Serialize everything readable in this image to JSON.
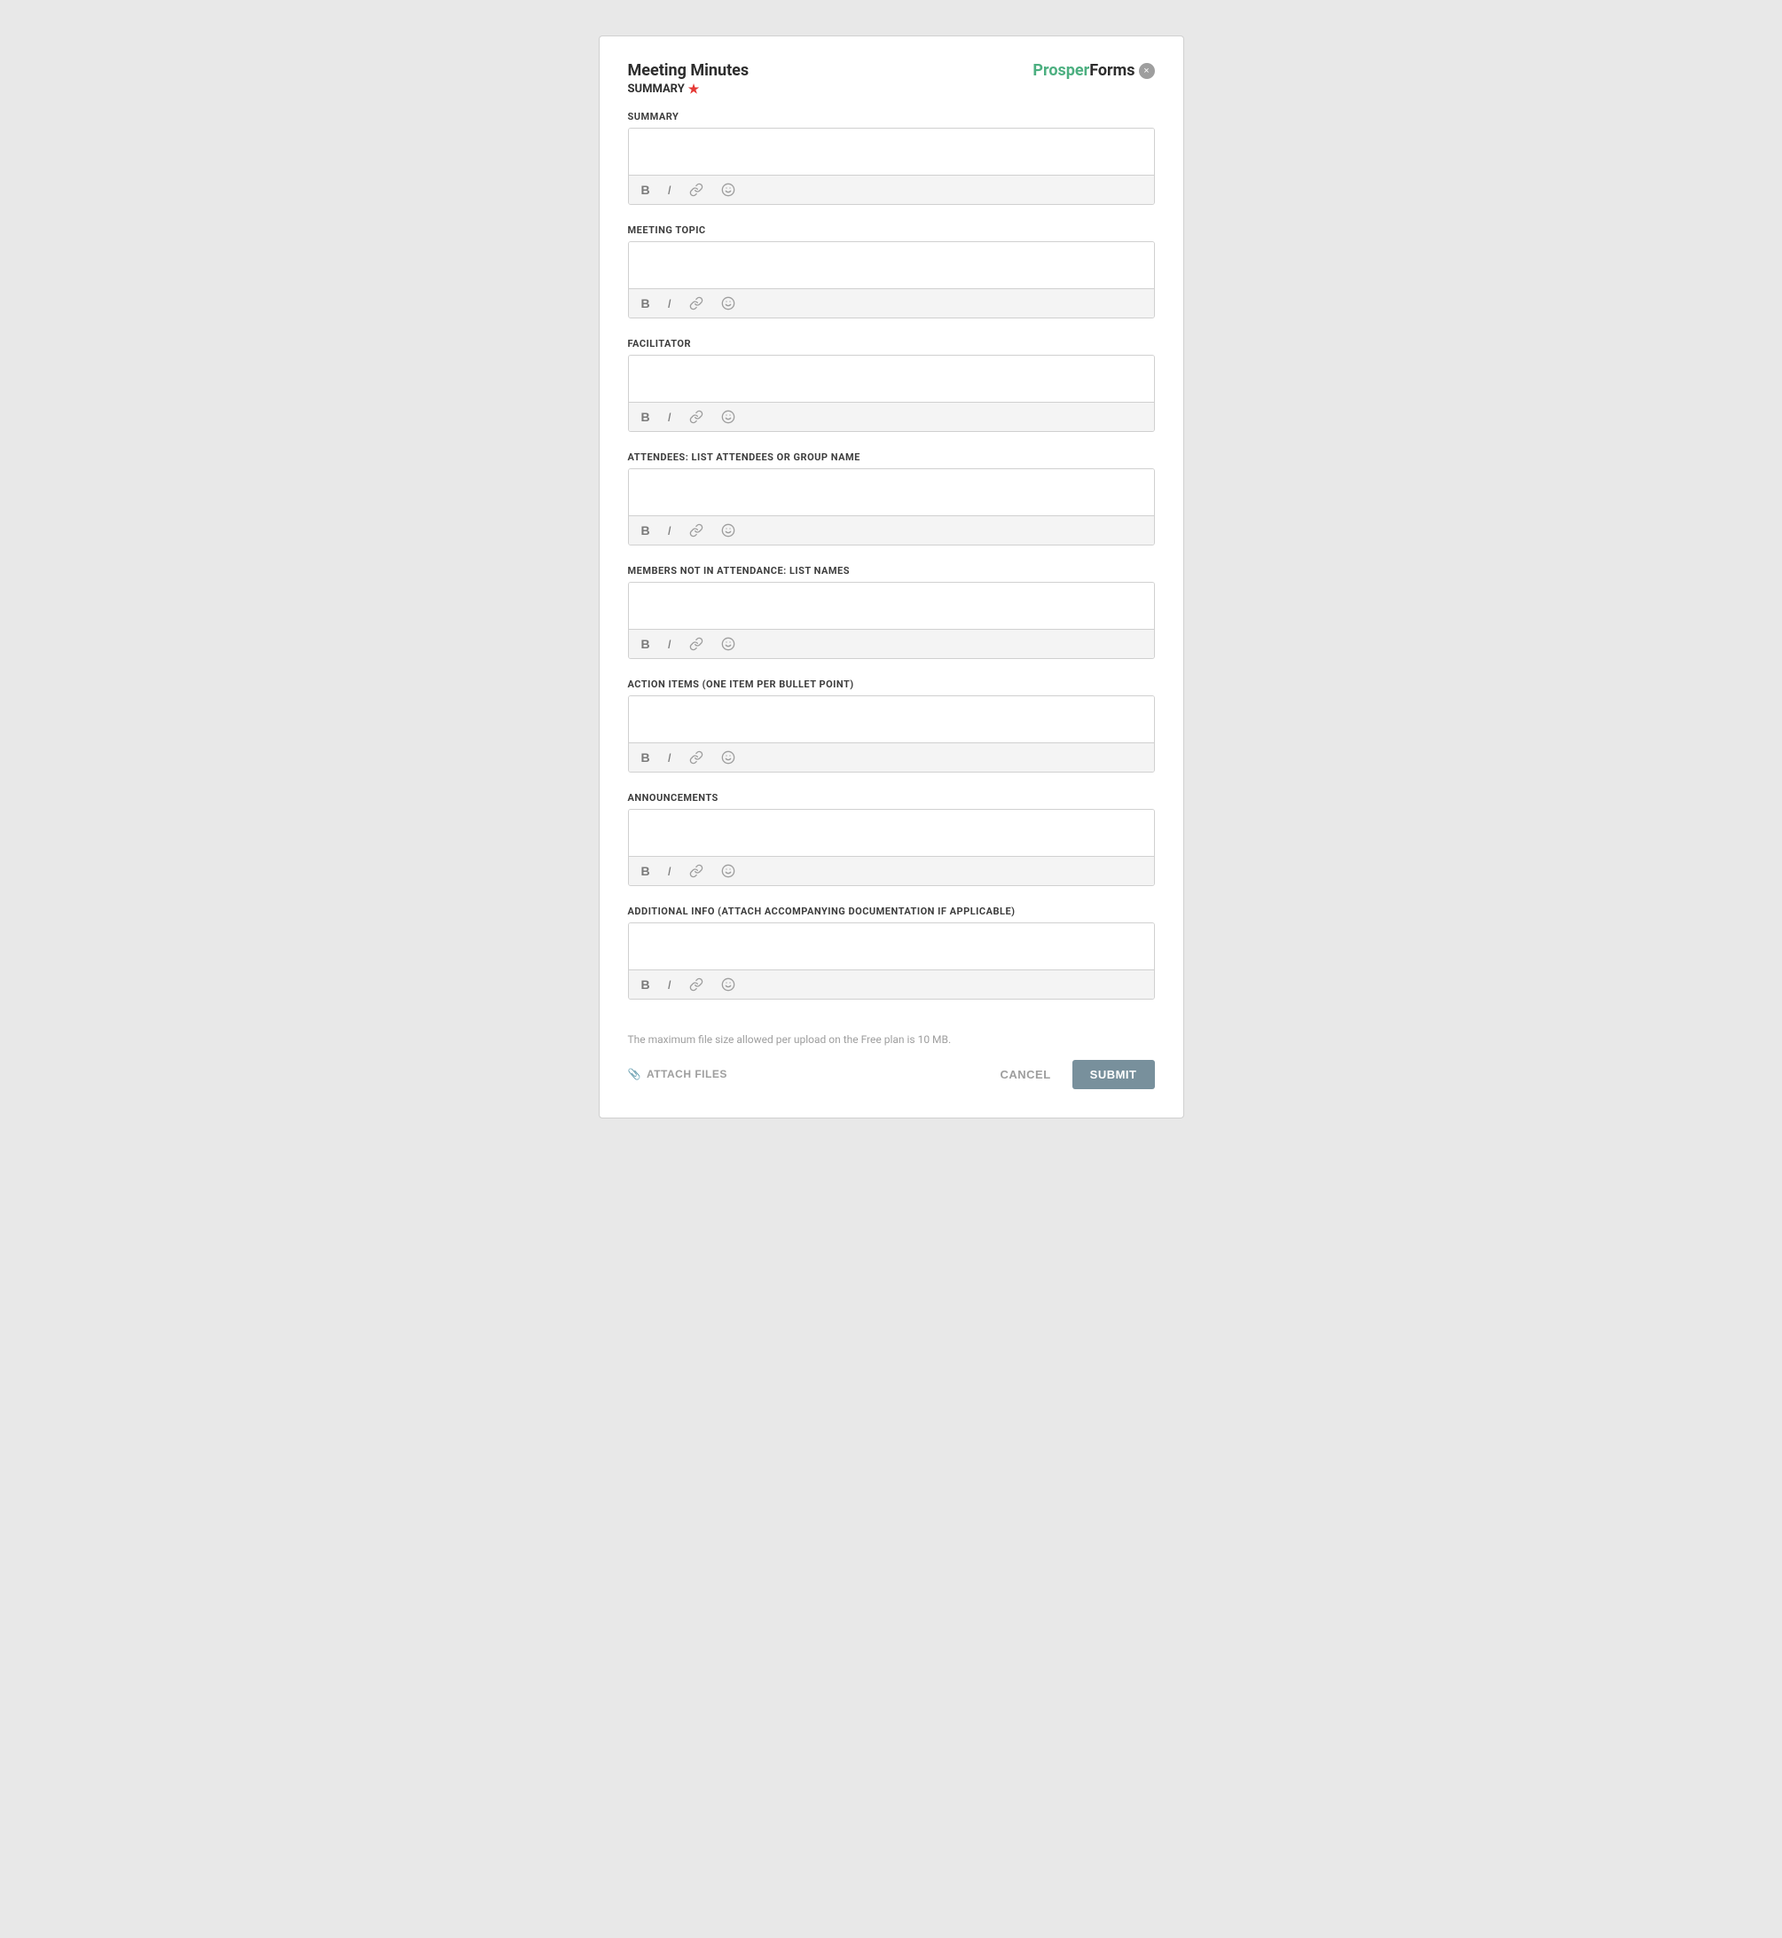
{
  "header": {
    "title": "Meeting Minutes",
    "subtitle": "SUMMARY",
    "required_indicator": "★",
    "logo_prosper": "Prosper",
    "logo_forms": "Forms",
    "close_label": "×"
  },
  "fields": [
    {
      "id": "summary",
      "label": "SUMMARY",
      "required": true,
      "placeholder": ""
    },
    {
      "id": "meeting_topic",
      "label": "MEETING TOPIC",
      "required": false,
      "placeholder": ""
    },
    {
      "id": "facilitator",
      "label": "FACILITATOR",
      "required": false,
      "placeholder": ""
    },
    {
      "id": "attendees",
      "label": "ATTENDEES: LIST ATTENDEES OR GROUP NAME",
      "required": false,
      "placeholder": ""
    },
    {
      "id": "members_not_attending",
      "label": "MEMBERS NOT IN ATTENDANCE: LIST NAMES",
      "required": false,
      "placeholder": ""
    },
    {
      "id": "action_items",
      "label": "ACTION ITEMS (ONE ITEM PER BULLET POINT)",
      "required": false,
      "placeholder": ""
    },
    {
      "id": "announcements",
      "label": "ANNOUNCEMENTS",
      "required": false,
      "placeholder": ""
    },
    {
      "id": "additional_info",
      "label": "ADDITIONAL INFO (ATTACH ACCOMPANYING DOCUMENTATION IF APPLICABLE)",
      "required": false,
      "placeholder": ""
    }
  ],
  "toolbar": {
    "bold": "B",
    "italic": "I"
  },
  "footer": {
    "file_size_note": "The maximum file size allowed per upload on the Free plan is 10 MB.",
    "attach_label": "ATTACH FILES",
    "cancel_label": "CANCEL",
    "submit_label": "SUBMIT"
  }
}
